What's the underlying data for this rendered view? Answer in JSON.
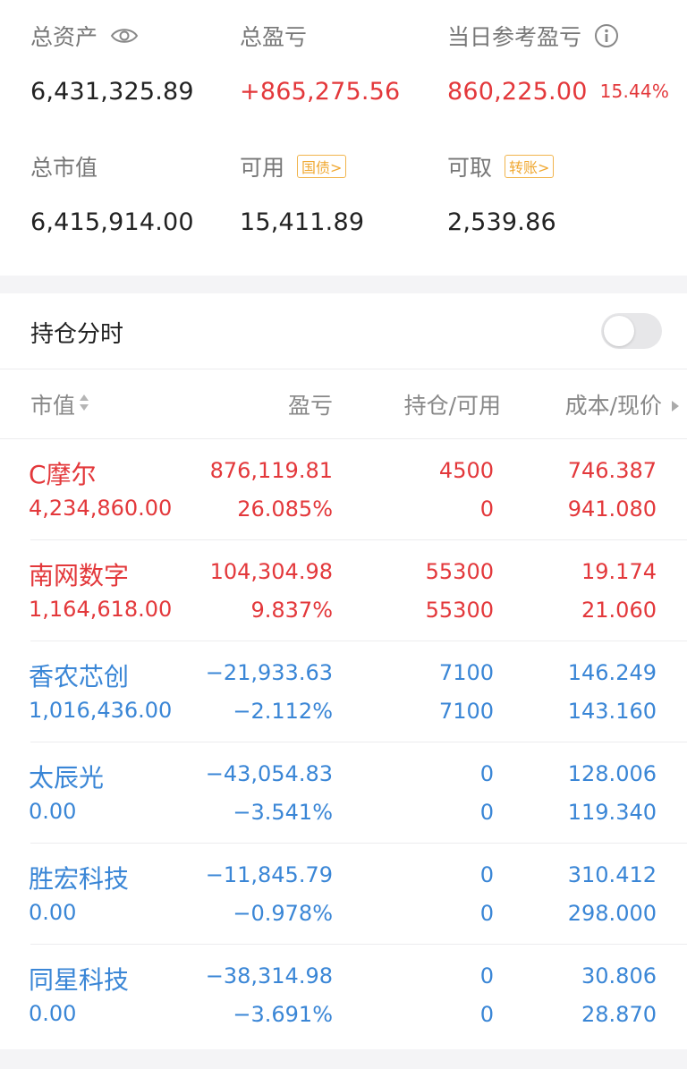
{
  "summary": {
    "total_assets": {
      "label": "总资产",
      "value": "6,431,325.89"
    },
    "total_pnl": {
      "label": "总盈亏",
      "value": "+865,275.56"
    },
    "daily_ref_pnl": {
      "label": "当日参考盈亏",
      "value": "860,225.00",
      "pct": "15.44%"
    },
    "market_value": {
      "label": "总市值",
      "value": "6,415,914.00"
    },
    "available": {
      "label": "可用",
      "value": "15,411.89",
      "tag": "国债>"
    },
    "withdrawable": {
      "label": "可取",
      "value": "2,539.86",
      "tag": "转账>"
    }
  },
  "positions": {
    "title": "持仓分时",
    "headers": {
      "market_value": "市值",
      "pnl": "盈亏",
      "holding": "持仓/可用",
      "cost_price": "成本/现价"
    },
    "rows": [
      {
        "name": "C摩尔",
        "market_value": "4,234,860.00",
        "pnl": "876,119.81",
        "pnl_pct": "26.085%",
        "holding": "4500",
        "available": "0",
        "cost": "746.387",
        "price": "941.080"
      },
      {
        "name": "南网数字",
        "market_value": "1,164,618.00",
        "pnl": "104,304.98",
        "pnl_pct": "9.837%",
        "holding": "55300",
        "available": "55300",
        "cost": "19.174",
        "price": "21.060"
      },
      {
        "name": "香农芯创",
        "market_value": "1,016,436.00",
        "pnl": "−21,933.63",
        "pnl_pct": "−2.112%",
        "holding": "7100",
        "available": "7100",
        "cost": "146.249",
        "price": "143.160"
      },
      {
        "name": "太辰光",
        "market_value": "0.00",
        "pnl": "−43,054.83",
        "pnl_pct": "−3.541%",
        "holding": "0",
        "available": "0",
        "cost": "128.006",
        "price": "119.340"
      },
      {
        "name": "胜宏科技",
        "market_value": "0.00",
        "pnl": "−11,845.79",
        "pnl_pct": "−0.978%",
        "holding": "0",
        "available": "0",
        "cost": "310.412",
        "price": "298.000"
      },
      {
        "name": "同星科技",
        "market_value": "0.00",
        "pnl": "−38,314.98",
        "pnl_pct": "−3.691%",
        "holding": "0",
        "available": "0",
        "cost": "30.806",
        "price": "28.870"
      }
    ]
  },
  "colors": {
    "gain": "#e3383b",
    "loss": "#3a86d6",
    "tag": "#f0a832"
  },
  "icons": {
    "eye": "eye-icon",
    "info": "info-icon",
    "sort": "sort-icon",
    "more": "play-icon"
  }
}
